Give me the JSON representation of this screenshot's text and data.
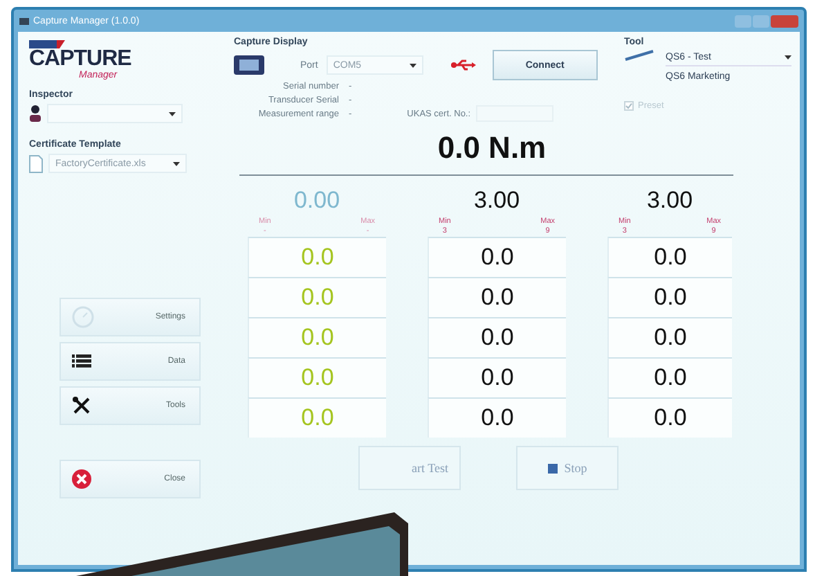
{
  "window": {
    "title": "Capture Manager (1.0.0)"
  },
  "logo": {
    "brand": "CAPTURE",
    "sub": "Manager"
  },
  "inspector": {
    "label": "Inspector"
  },
  "certificate_template": {
    "label": "Certificate Template",
    "value": "FactoryCertificate.xls"
  },
  "nav_buttons": [
    {
      "label": "Settings",
      "kind": "gauge"
    },
    {
      "label": "Data",
      "kind": "list"
    },
    {
      "label": "Tools",
      "kind": "tools"
    }
  ],
  "close_button": {
    "label": "Close"
  },
  "capture_display": {
    "title": "Capture Display",
    "port_label": "Port",
    "port_value": "COM5",
    "connect": "Connect",
    "fields": [
      {
        "label": "Serial number",
        "value": "-"
      },
      {
        "label": "Transducer Serial",
        "value": "-"
      },
      {
        "label": "Measurement range",
        "value": "-"
      }
    ],
    "ukas_label": "UKAS cert. No.:"
  },
  "tool": {
    "title": "Tool",
    "value": "QS6 - Test",
    "subtitle": "QS6 Marketing",
    "preset": {
      "label": "Preset",
      "checked": true,
      "disabled": true
    }
  },
  "reading": "0.0 N.m",
  "columns": [
    {
      "kind": "live",
      "value": "0.00",
      "min_label": "Min",
      "min": "-",
      "max_label": "Max",
      "max": "-",
      "cells": [
        "0.0",
        "0.0",
        "0.0",
        "0.0",
        "0.0"
      ]
    },
    {
      "kind": "set",
      "value": "3.00",
      "min_label": "Min",
      "min": "3",
      "max_label": "Max",
      "max": "9",
      "cells": [
        "0.0",
        "0.0",
        "0.0",
        "0.0",
        "0.0"
      ]
    },
    {
      "kind": "set",
      "value": "3.00",
      "min_label": "Min",
      "min": "3",
      "max_label": "Max",
      "max": "9",
      "cells": [
        "0.0",
        "0.0",
        "0.0",
        "0.0",
        "0.0"
      ]
    }
  ],
  "start_button": {
    "label": "art Test"
  },
  "stop_button": {
    "label": "Stop"
  }
}
